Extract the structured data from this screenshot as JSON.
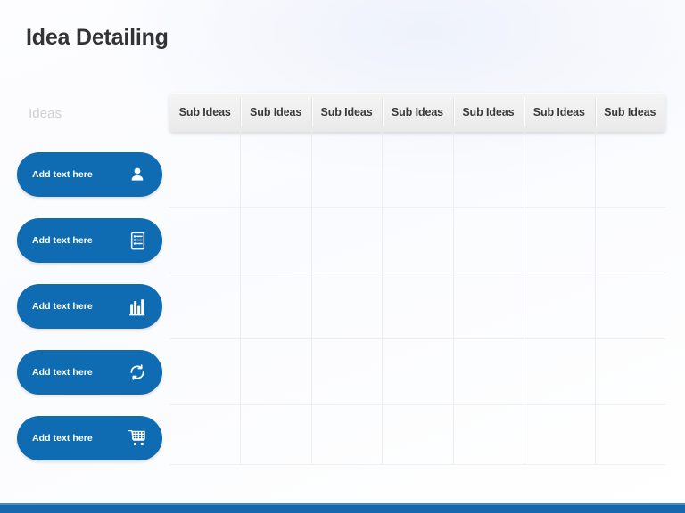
{
  "slide": {
    "title": "Idea Detailing",
    "colors": {
      "pill_blue": "#0f6cb2",
      "bottom_bar_blue": "#1468ab",
      "bottom_bar_top_line": "#3f8fd0",
      "title_text": "#333333",
      "ideas_label": "#cfcfcf",
      "header_text": "#3b3b3b",
      "grid_line": "#eceef1",
      "background": "#fafbfe"
    }
  },
  "left_column": {
    "label": "Ideas",
    "ideas": [
      {
        "text": "Add text here",
        "icon": "user-icon"
      },
      {
        "text": "Add text here",
        "icon": "list-document-icon"
      },
      {
        "text": "Add text here",
        "icon": "bar-chart-icon"
      },
      {
        "text": "Add text here",
        "icon": "refresh-cycle-icon"
      },
      {
        "text": "Add text here",
        "icon": "shopping-cart-icon"
      }
    ]
  },
  "table": {
    "headers": [
      "Sub Ideas",
      "Sub Ideas",
      "Sub Ideas",
      "Sub Ideas",
      "Sub Ideas",
      "Sub Ideas",
      "Sub Ideas"
    ],
    "column_count": 7,
    "row_count": 5,
    "cells_empty": true
  }
}
